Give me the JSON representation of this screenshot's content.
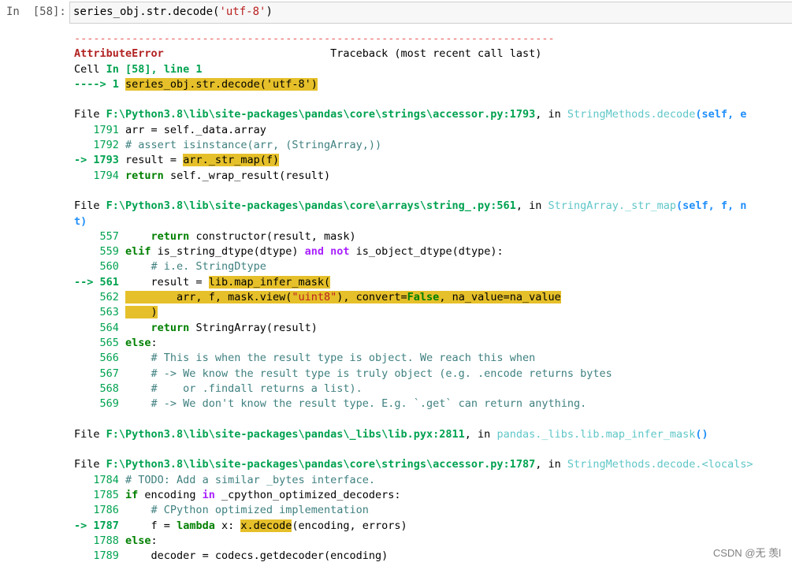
{
  "prompt": "In  [58]:",
  "input": {
    "code_prefix": "series_obj.str.decode(",
    "code_string": "'utf-8'",
    "code_suffix": ")"
  },
  "traceback": {
    "dashes": "---------------------------------------------------------------------------",
    "error_name": "AttributeError",
    "header_pad": "                          ",
    "header_text": "Traceback (most recent call last)",
    "cell_prefix": "Cell ",
    "cell_ref": "In [58], line 1",
    "l1_arrow": "----> 1 ",
    "l1_code": "series_obj.str.decode('utf-8')",
    "file_word": "File ",
    "in_word": ", in ",
    "f1_path": "F:\\Python3.8\\lib\\site-packages\\pandas\\core\\strings\\accessor.py:1793",
    "f1_func": "StringMethods.decode",
    "f1_sig": "(self, e",
    "f1_l1791_no": "   1791 ",
    "f1_l1791_code": "arr = self._data.array",
    "f1_l1792_no": "   1792 ",
    "f1_l1792_code": "# assert isinstance(arr, (StringArray,))",
    "f1_l1793_arrow": "-> 1793 ",
    "f1_l1793_a": "result = ",
    "f1_l1793_hl": "arr._str_map(f)",
    "f1_l1794_no": "   1794 ",
    "f1_l1794_kw": "return",
    "f1_l1794_code": " self._wrap_result(result)",
    "f2_path": "F:\\Python3.8\\lib\\site-packages\\pandas\\core\\arrays\\string_.py:561",
    "f2_func": "StringArray._str_map",
    "f2_sig": "(self, f, n",
    "f2_wrap": "t)",
    "f2_l557_no": "    557 ",
    "f2_l557_indent": "    ",
    "f2_l557_kw": "return",
    "f2_l557_code": " constructor(result, mask)",
    "f2_l559_no": "    559 ",
    "f2_l559_kw": "elif",
    "f2_l559_a": " is_string_dtype(dtype) ",
    "f2_l559_and": "and",
    "f2_l559_sp": " ",
    "f2_l559_not": "not",
    "f2_l559_b": " is_object_dtype(dtype):",
    "f2_l560_no": "    560 ",
    "f2_l560_code": "    # i.e. StringDtype",
    "f2_l561_arrow": "--> 561 ",
    "f2_l561_a": "    result = ",
    "f2_l561_hl": "lib.map_infer_mask(",
    "f2_l562_no": "    562 ",
    "f2_l562_a": "        arr, f, mask.view(",
    "f2_l562_str": "\"uint8\"",
    "f2_l562_b": "), convert=",
    "f2_l562_false": "False",
    "f2_l562_c": ", na_value=na_value",
    "f2_l563_no": "    563 ",
    "f2_l563_code": "    )",
    "f2_l564_no": "    564 ",
    "f2_l564_indent": "    ",
    "f2_l564_kw": "return",
    "f2_l564_code": " StringArray(result)",
    "f2_l565_no": "    565 ",
    "f2_l565_kw": "else",
    "f2_l565_code": ":",
    "f2_l566_no": "    566 ",
    "f2_l566_code": "    # This is when the result type is object. We reach this when",
    "f2_l567_no": "    567 ",
    "f2_l567_code": "    # -> We know the result type is truly object (e.g. .encode returns bytes",
    "f2_l568_no": "    568 ",
    "f2_l568_code": "    #    or .findall returns a list).",
    "f2_l569_no": "    569 ",
    "f2_l569_code": "    # -> We don't know the result type. E.g. `.get` can return anything.",
    "f3_path": "F:\\Python3.8\\lib\\site-packages\\pandas\\_libs\\lib.pyx:2811",
    "f3_func": "pandas._libs.lib.map_infer_mask",
    "f3_sig": "()",
    "f4_path": "F:\\Python3.8\\lib\\site-packages\\pandas\\core\\strings\\accessor.py:1787",
    "f4_func": "StringMethods.decode.<locals>",
    "f4_l1784_no": "   1784 ",
    "f4_l1784_code": "# TODO: Add a similar _bytes interface.",
    "f4_l1785_no": "   1785 ",
    "f4_l1785_kw": "if",
    "f4_l1785_a": " encoding ",
    "f4_l1785_in": "in",
    "f4_l1785_b": " _cpython_optimized_decoders:",
    "f4_l1786_no": "   1786 ",
    "f4_l1786_code": "    # CPython optimized implementation",
    "f4_l1787_arrow": "-> 1787 ",
    "f4_l1787_a": "    f = ",
    "f4_l1787_kw": "lambda",
    "f4_l1787_b": " x: ",
    "f4_l1787_hl": "x.decode",
    "f4_l1787_c": "(encoding, errors)",
    "f4_l1788_no": "   1788 ",
    "f4_l1788_kw": "else",
    "f4_l1788_code": ":",
    "f4_l1789_no": "   1789 ",
    "f4_l1789_code": "    decoder = codecs.getdecoder(encoding)"
  },
  "watermark": "CSDN @无 羡l",
  "colors": {
    "highlight": "#e6c02a",
    "error": "#b22222",
    "green": "#00a250",
    "cyan": "#60c6c8"
  }
}
